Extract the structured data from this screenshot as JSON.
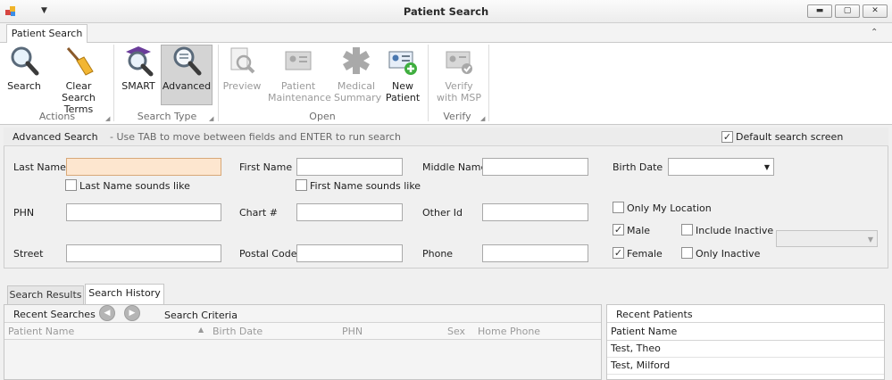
{
  "window": {
    "title": "Patient Search"
  },
  "ribbon": {
    "tab": "Patient Search",
    "groups": {
      "actions": {
        "label": "Actions",
        "search": "Search",
        "clear_line1": "Clear Search",
        "clear_line2": "Terms"
      },
      "search_type": {
        "label": "Search Type",
        "smart": "SMART",
        "advanced": "Advanced"
      },
      "open": {
        "label": "Open",
        "preview": "Preview",
        "maint_line1": "Patient",
        "maint_line2": "Maintenance",
        "medsum_line1": "Medical",
        "medsum_line2": "Summary",
        "newpat_line1": "New",
        "newpat_line2": "Patient"
      },
      "verify": {
        "label": "Verify",
        "msp_line1": "Verify",
        "msp_line2": "with MSP"
      }
    }
  },
  "advanced_search": {
    "title": "Advanced Search",
    "hint": "- Use TAB to move between fields and ENTER to run search",
    "default_screen_label": "Default search screen",
    "default_screen_checked": true,
    "fields": {
      "last_name": {
        "label": "Last Name",
        "value": ""
      },
      "first_name": {
        "label": "First Name",
        "value": ""
      },
      "middle_name": {
        "label": "Middle Name",
        "value": ""
      },
      "birth_date": {
        "label": "Birth Date",
        "value": ""
      },
      "phn": {
        "label": "PHN",
        "value": ""
      },
      "chart": {
        "label": "Chart #",
        "value": ""
      },
      "other_id": {
        "label": "Other Id",
        "value": ""
      },
      "street": {
        "label": "Street",
        "value": ""
      },
      "postal_code": {
        "label": "Postal Code",
        "value": ""
      },
      "phone": {
        "label": "Phone",
        "value": ""
      }
    },
    "checks": {
      "last_name_sounds": {
        "label": "Last Name sounds like",
        "checked": false
      },
      "first_name_sounds": {
        "label": "First Name sounds like",
        "checked": false
      },
      "only_my_location": {
        "label": "Only My Location",
        "checked": false
      },
      "male": {
        "label": "Male",
        "checked": true
      },
      "female": {
        "label": "Female",
        "checked": true
      },
      "include_inactive": {
        "label": "Include Inactive",
        "checked": false
      },
      "only_inactive": {
        "label": "Only Inactive",
        "checked": false
      }
    }
  },
  "results_tabs": [
    "Search Results",
    "Search History"
  ],
  "active_results_tab": "Search History",
  "recent_searches": {
    "title": "Recent Searches",
    "criteria_label": "Search Criteria",
    "columns": [
      "Patient Name",
      "Birth Date",
      "PHN",
      "Sex",
      "Home Phone"
    ]
  },
  "recent_patients": {
    "title": "Recent Patients",
    "column": "Patient Name",
    "rows": [
      "Test, Theo",
      "Test, Milford"
    ]
  },
  "colors": {
    "focused_input_bg": "#fde6cf",
    "active_button_bg": "#d4d4d4"
  }
}
